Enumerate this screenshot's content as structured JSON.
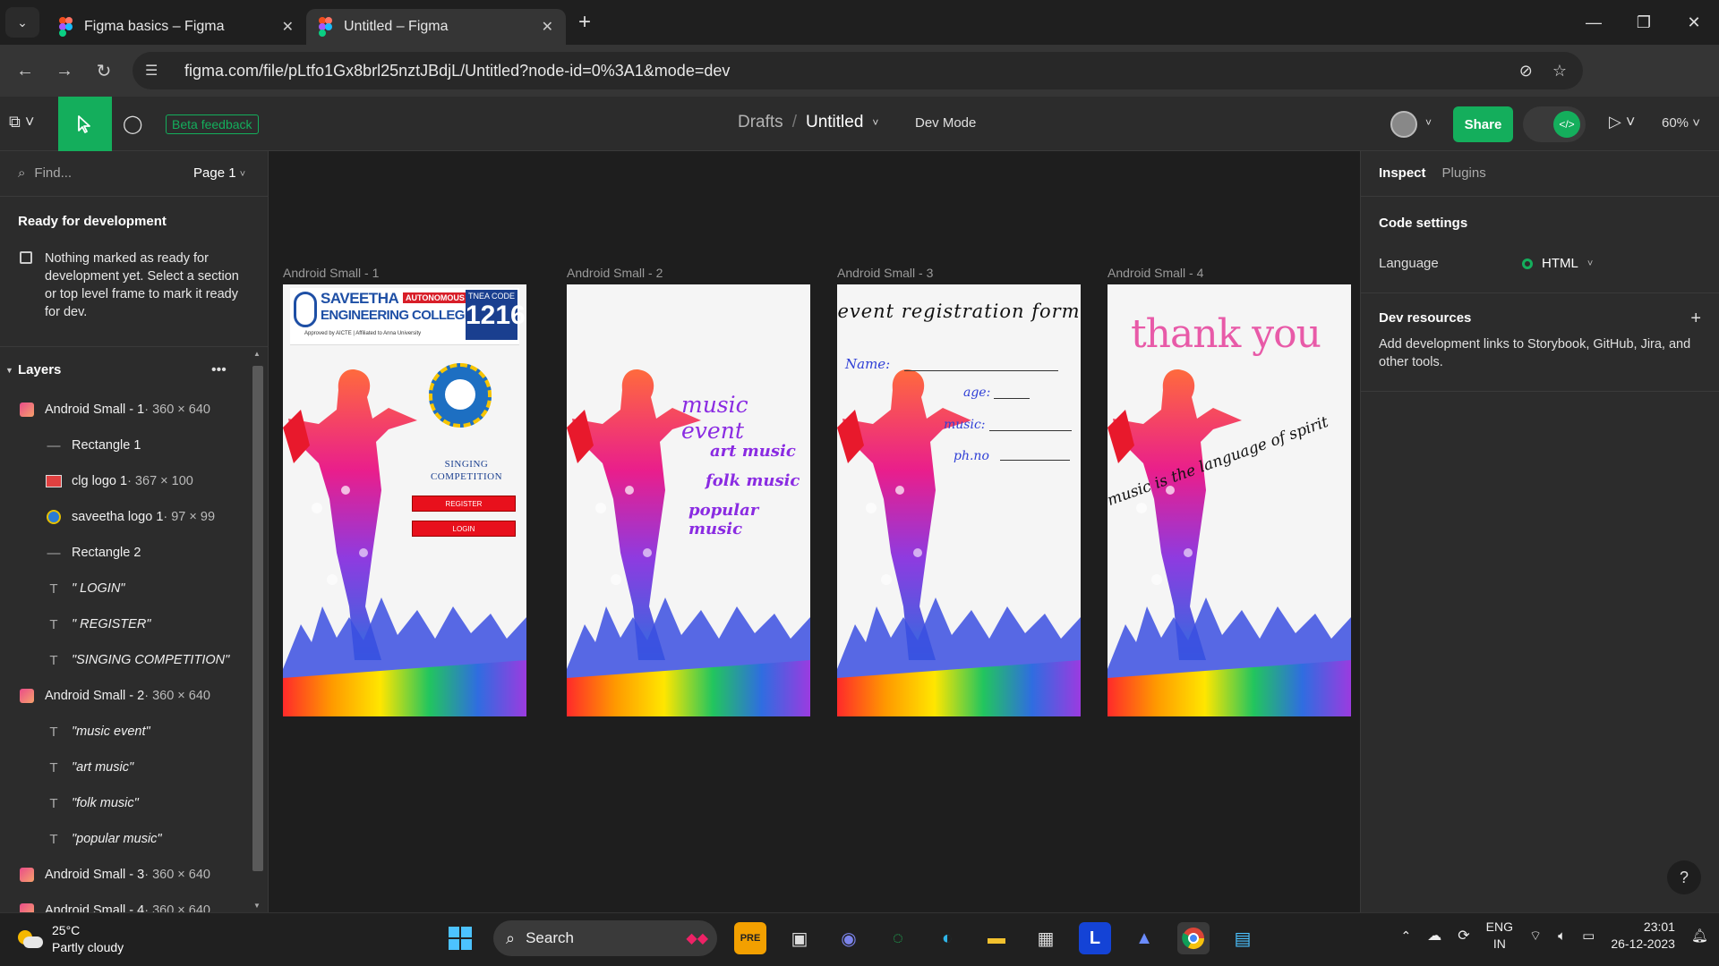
{
  "browser": {
    "tabs": [
      {
        "title": "Figma basics – Figma",
        "active": false
      },
      {
        "title": "Untitled – Figma",
        "active": true
      }
    ],
    "url": "figma.com/file/pLtfo1Gx8brl25nztJBdjL/Untitled?node-id=0%3A1&mode=dev"
  },
  "toolbar": {
    "beta_label": "Beta feedback",
    "drafts_label": "Drafts",
    "separator": "/",
    "file_name": "Untitled",
    "dev_mode_label": "Dev Mode",
    "share_label": "Share",
    "zoom": "60%"
  },
  "left_panel": {
    "find_placeholder": "Find...",
    "page_label": "Page 1",
    "ready_title": "Ready for development",
    "ready_text": "Nothing marked as ready for development yet. Select a section or top level frame to mark it ready for dev.",
    "layers_title": "Layers",
    "layers": [
      {
        "name": "Android Small - 1",
        "dims": " · 360 × 640",
        "type": "frame",
        "indent": false
      },
      {
        "name": "Rectangle 1",
        "dims": "",
        "type": "rect",
        "indent": true
      },
      {
        "name": "clg logo 1",
        "dims": " · 367 × 100",
        "type": "image",
        "indent": true
      },
      {
        "name": "saveetha logo 1",
        "dims": " · 97 × 99",
        "type": "image2",
        "indent": true
      },
      {
        "name": "Rectangle 2",
        "dims": "",
        "type": "rect",
        "indent": true
      },
      {
        "name": "\" LOGIN\"",
        "dims": "",
        "type": "text",
        "indent": true
      },
      {
        "name": "\" REGISTER\"",
        "dims": "",
        "type": "text",
        "indent": true
      },
      {
        "name": "\"SINGING COMPETITION\"",
        "dims": "",
        "type": "text",
        "indent": true
      },
      {
        "name": "Android Small - 2",
        "dims": " · 360 × 640",
        "type": "frame",
        "indent": false
      },
      {
        "name": "\"music event\"",
        "dims": "",
        "type": "text",
        "indent": true
      },
      {
        "name": "\"art music\"",
        "dims": "",
        "type": "text",
        "indent": true
      },
      {
        "name": "\"folk music\"",
        "dims": "",
        "type": "text",
        "indent": true
      },
      {
        "name": "\"popular music\"",
        "dims": "",
        "type": "text",
        "indent": true
      },
      {
        "name": "Android Small - 3",
        "dims": " · 360 × 640",
        "type": "frame",
        "indent": false
      },
      {
        "name": "Android Small - 4",
        "dims": " · 360 × 640",
        "type": "frame",
        "indent": false
      }
    ]
  },
  "canvas": {
    "frame_labels": [
      "Android Small - 1",
      "Android Small - 2",
      "Android Small - 3",
      "Android Small - 4"
    ],
    "frame1": {
      "college_name_line1": "SAVEETHA",
      "autonomous": "AUTONOMOUS",
      "college_name_line2": "ENGINEERING COLLEGE",
      "approval": "Approved by AICTE | Affiliated to Anna University",
      "tnea_label": "TNEA CODE",
      "tnea_code": "1216",
      "competition_line1": "SINGING",
      "competition_line2": "COMPETITION",
      "register_label": "REGISTER",
      "login_label": "LOGIN"
    },
    "frame2": {
      "title": "music event",
      "items": [
        "art music",
        "folk music",
        "popular music"
      ]
    },
    "frame3": {
      "title": "event registration form",
      "fields": [
        "Name:",
        "age:",
        "music:",
        "ph.no"
      ]
    },
    "frame4": {
      "title": "thank you",
      "quote": "music is the language of spirit"
    }
  },
  "right_panel": {
    "tab_inspect": "Inspect",
    "tab_plugins": "Plugins",
    "code_settings_title": "Code settings",
    "language_label": "Language",
    "language_value": "HTML",
    "dev_resources_title": "Dev resources",
    "dev_resources_text": "Add development links to Storybook, GitHub, Jira, and other tools.",
    "help_label": "?"
  },
  "taskbar": {
    "temperature": "25°C",
    "weather": "Partly cloudy",
    "search_label": "Search",
    "lang_line1": "ENG",
    "lang_line2": "IN",
    "time": "23:01",
    "date": "26-12-2023"
  },
  "colors": {
    "figma_green": "#14ae5c",
    "panel_bg": "#2c2c2c",
    "canvas_bg": "#1e1e1e",
    "button_red": "#e8101c",
    "music_purple": "#8a2be2",
    "form_blue": "#2f3fd6",
    "thankyou_pink": "#e85aa8"
  }
}
